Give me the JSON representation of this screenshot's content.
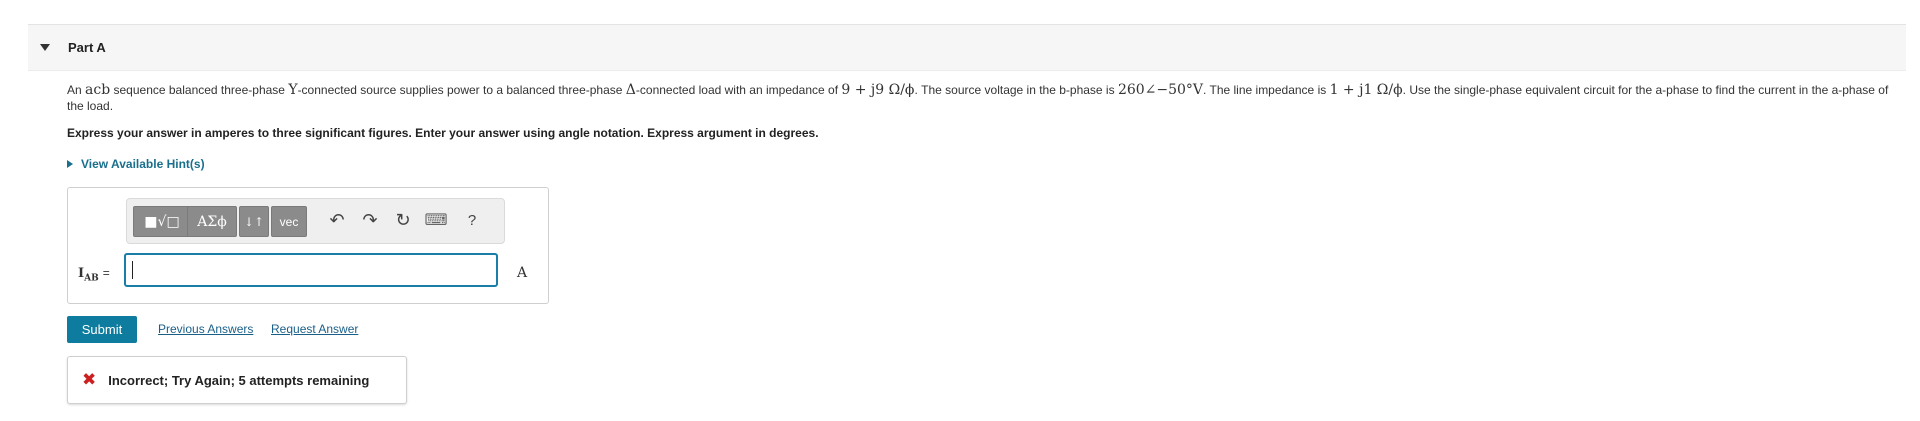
{
  "part": {
    "title": "Part A"
  },
  "problem": {
    "s1": "An ",
    "m1": "acb",
    "s2": " sequence balanced three-phase ",
    "m2": "Y",
    "s3": "-connected source supplies power to a balanced three-phase ",
    "m3": "Δ",
    "s4": "-connected load with an impedance of ",
    "m4": "9 + j9 Ω/ϕ",
    "s5": ". The source voltage in the b-phase is ",
    "m5": "260∠−50°V",
    "s6": ". The line impedance is ",
    "m6": "1 + j1 Ω/ϕ",
    "s7": ". Use the single-phase equivalent circuit for the a-phase to find the current in the a-phase of the load."
  },
  "instructions": "Express your answer in amperes to three significant figures. Enter your answer using angle notation. Express argument in degrees.",
  "hints_label": "View Available Hint(s)",
  "toolbar": {
    "templates_label": "■√□",
    "greek_label": "ΑΣϕ",
    "arrows_label": "↓↑",
    "vec_label": "vec",
    "undo_icon": "↶",
    "redo_icon": "↷",
    "reset_icon": "↻",
    "keyboard_icon": "⌨",
    "help_label": "?"
  },
  "answer": {
    "label_main": "I",
    "label_sub": "AB",
    "label_eq": "=",
    "value": "",
    "unit": "A"
  },
  "actions": {
    "submit_label": "Submit",
    "previous_answers_label": "Previous Answers",
    "request_answer_label": "Request Answer"
  },
  "feedback": {
    "icon": "✖",
    "text": "Incorrect; Try Again; 5 attempts remaining"
  },
  "colors": {
    "accent": "#0e7c9e",
    "link": "#1a6f8c",
    "error": "#cc1f1f"
  }
}
